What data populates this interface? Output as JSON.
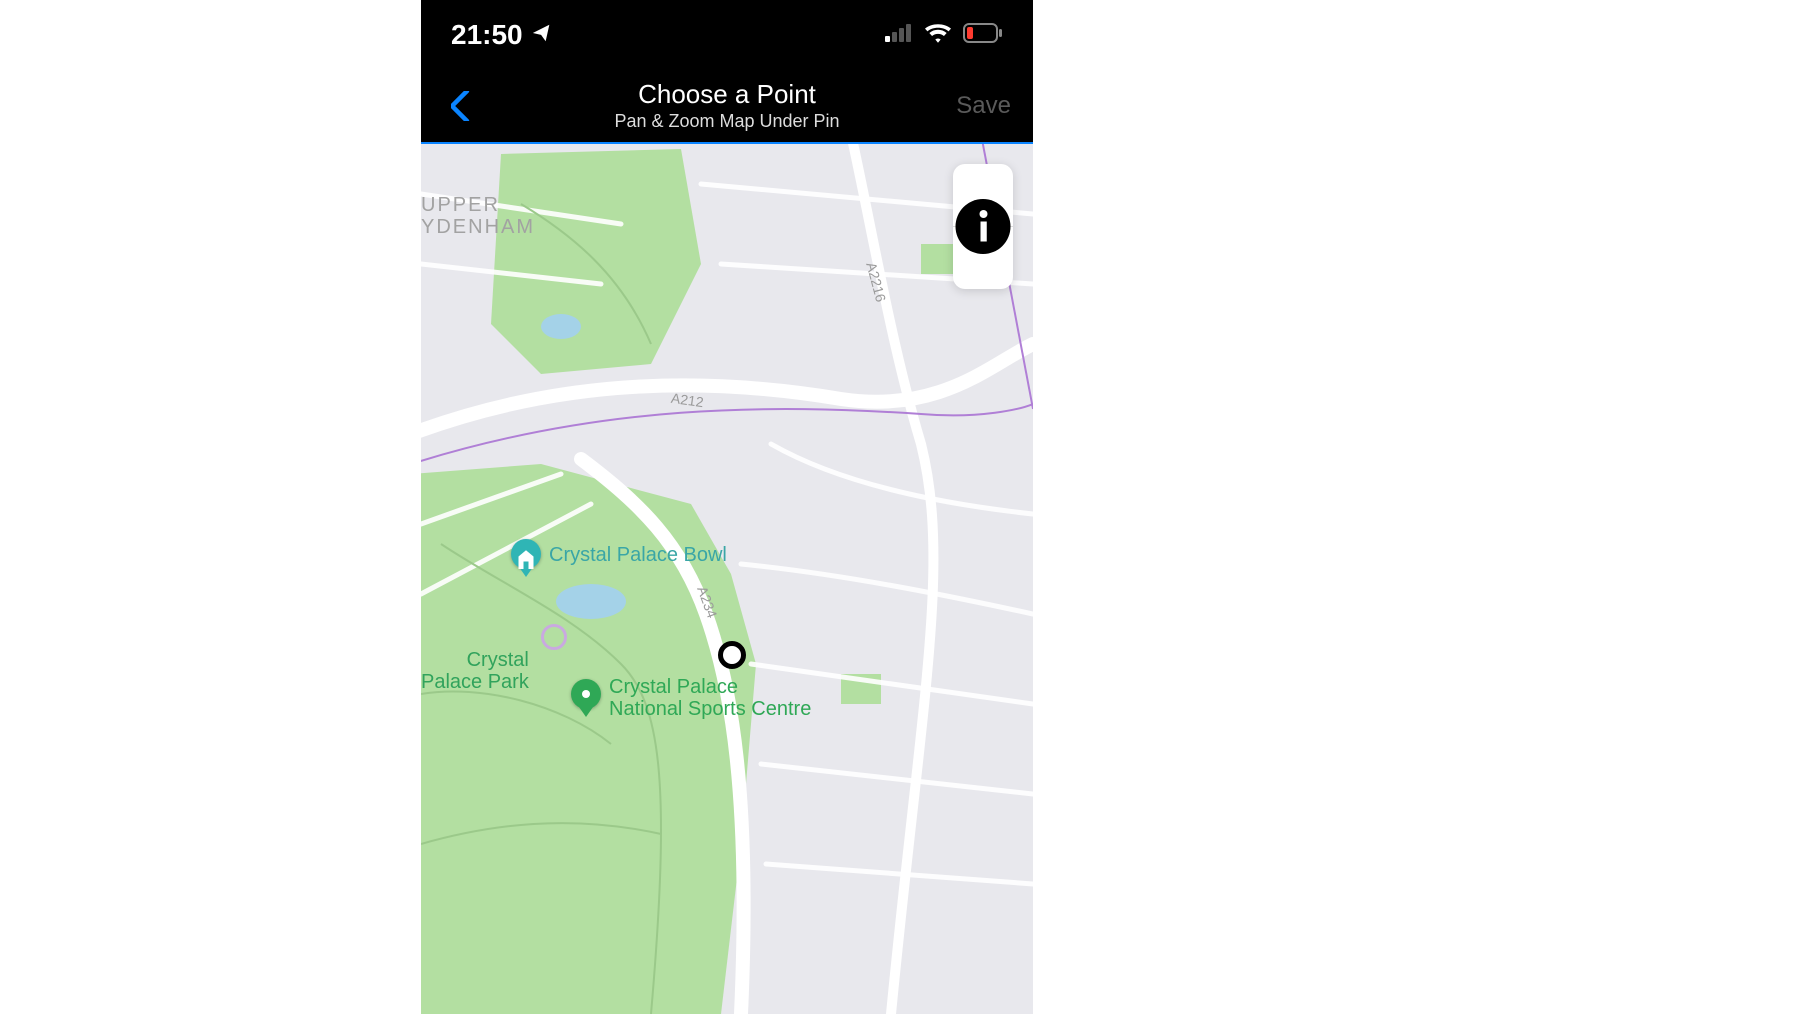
{
  "status": {
    "time": "21:50",
    "signal_bars_active": 1,
    "signal_bars_total": 4,
    "wifi": true,
    "battery_low": true
  },
  "nav": {
    "title": "Choose a Point",
    "subtitle": "Pan & Zoom Map Under Pin",
    "save_label": "Save"
  },
  "map": {
    "area_label_1": "UPPER",
    "area_label_2": "YDENHAM",
    "roads": {
      "a212": "A212",
      "a234": "A234",
      "a2216": "A2216"
    },
    "park_label": "Crystal\nPalace Park",
    "pois": {
      "bowl": "Crystal Palace Bowl",
      "sports_centre": "Crystal Palace\nNational Sports Centre"
    },
    "layers_icon": "layers-icon",
    "info_icon": "info-icon",
    "station_icon": "penge-west-station"
  }
}
